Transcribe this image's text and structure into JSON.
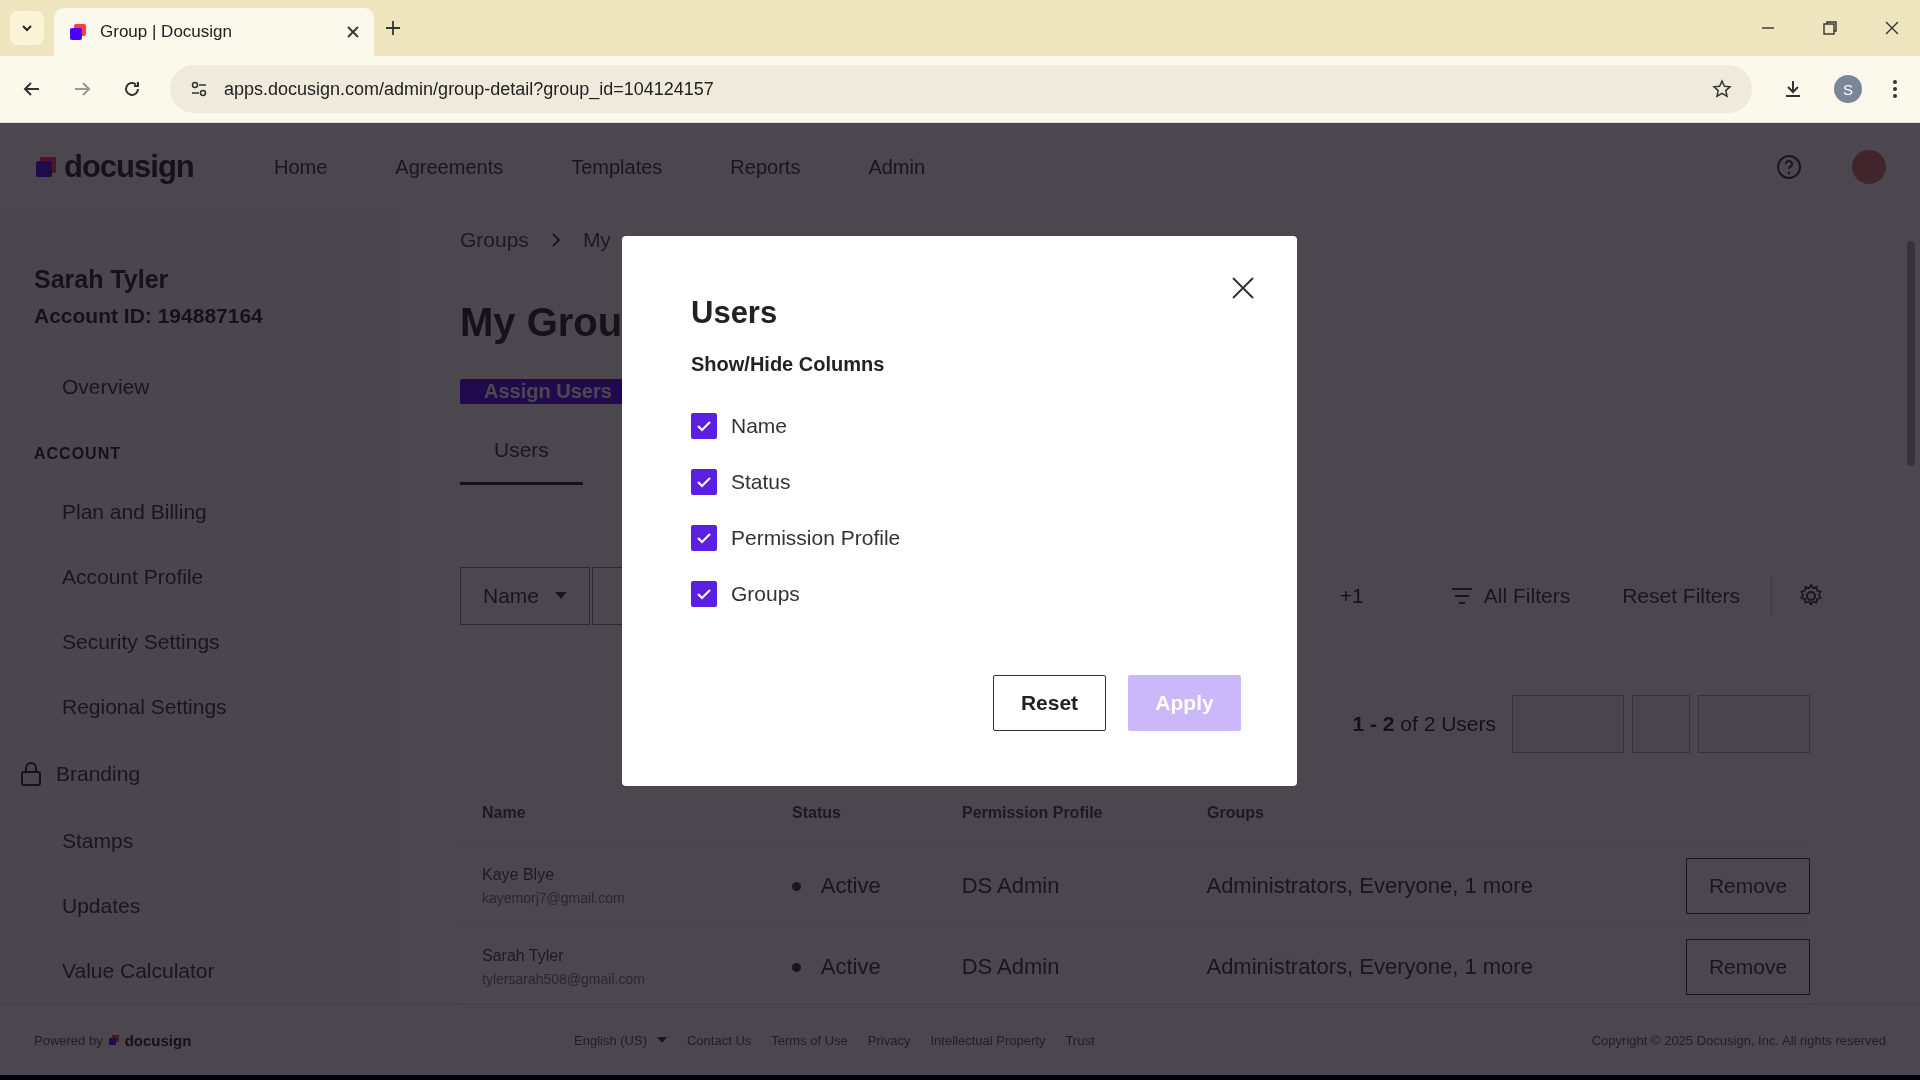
{
  "browser": {
    "tab_title": "Group | Docusign",
    "url": "apps.docusign.com/admin/group-detail?group_id=104124157",
    "profile_initial": "S"
  },
  "header": {
    "logo": "docusign",
    "nav": [
      "Home",
      "Agreements",
      "Templates",
      "Reports",
      "Admin"
    ]
  },
  "sidebar": {
    "user_name": "Sarah Tyler",
    "account_id": "Account ID: 194887164",
    "items": [
      {
        "label": "Overview",
        "kind": "link"
      },
      {
        "label": "ACCOUNT",
        "kind": "heading"
      },
      {
        "label": "Plan and Billing",
        "kind": "link"
      },
      {
        "label": "Account Profile",
        "kind": "link"
      },
      {
        "label": "Security Settings",
        "kind": "link"
      },
      {
        "label": "Regional Settings",
        "kind": "link"
      },
      {
        "label": "Branding",
        "kind": "locked"
      },
      {
        "label": "Stamps",
        "kind": "link"
      },
      {
        "label": "Updates",
        "kind": "link"
      },
      {
        "label": "Value Calculator",
        "kind": "link"
      }
    ]
  },
  "main": {
    "breadcrumb": [
      "Groups",
      "My"
    ],
    "title": "My Grou",
    "assign_button": "Assign Users",
    "tabs": [
      {
        "label": "Users",
        "selected": true
      }
    ],
    "filter": {
      "field": "Name",
      "more": "+1",
      "all_filters": "All Filters",
      "reset_filters": "Reset Filters"
    },
    "pagination": {
      "summary": "**1 - 2** of 2 Users"
    },
    "table": {
      "columns": [
        "Name",
        "Status",
        "Permission Profile",
        "Groups"
      ],
      "rows": [
        {
          "name": "Kaye Blye",
          "email": "kayemorj7@gmail.com",
          "status": "Active",
          "permission_profile": "DS Admin",
          "groups": "Administrators, Everyone, 1 more",
          "action": "Remove"
        },
        {
          "name": "Sarah Tyler",
          "email": "tylersarah508@gmail.com",
          "status": "Active",
          "permission_profile": "DS Admin",
          "groups": "Administrators, Everyone, 1 more",
          "action": "Remove"
        }
      ]
    }
  },
  "dialog": {
    "title": "Users",
    "subtitle": "Show/Hide Columns",
    "options": [
      {
        "label": "Name",
        "checked": true
      },
      {
        "label": "Status",
        "checked": true
      },
      {
        "label": "Permission Profile",
        "checked": true
      },
      {
        "label": "Groups",
        "checked": true
      }
    ],
    "buttons": [
      {
        "label": "Reset",
        "kind": "secondary",
        "disabled": false
      },
      {
        "label": "Apply",
        "kind": "primary",
        "disabled": true
      }
    ]
  },
  "footer": {
    "powered_by": "Powered by",
    "logo": "docusign",
    "language": "English (US)",
    "links": [
      "Contact Us",
      "Terms of Use",
      "Privacy",
      "Intellectual Property",
      "Trust"
    ],
    "copyright": "Copyright © 2025 Docusign, Inc. All rights reserved"
  }
}
